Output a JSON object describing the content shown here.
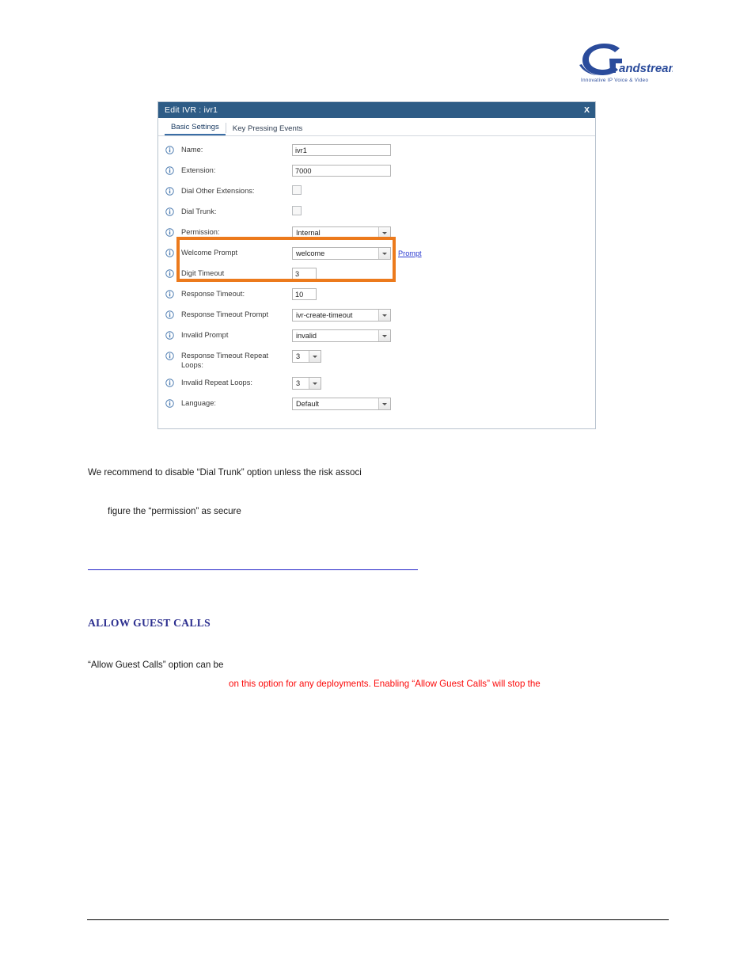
{
  "brand": {
    "name": "Grandstream",
    "tagline": "Innovative IP Voice & Video",
    "logo_color": "#2a4b9b"
  },
  "dialog": {
    "title": "Edit IVR : ivr1",
    "close_label": "X",
    "tabs": [
      {
        "label": "Basic Settings",
        "active": true
      },
      {
        "label": "Key Pressing Events",
        "active": false
      }
    ],
    "highlight_color": "#ec7a1c",
    "titlebar_color": "#2e5c86",
    "fields": [
      {
        "label": "Name:",
        "type": "text",
        "value": "ivr1"
      },
      {
        "label": "Extension:",
        "type": "text",
        "value": "7000"
      },
      {
        "label": "Dial Other Extensions:",
        "type": "checkbox",
        "checked": false
      },
      {
        "label": "Dial Trunk:",
        "type": "checkbox",
        "checked": false
      },
      {
        "label": "Permission:",
        "type": "select",
        "value": "Internal"
      },
      {
        "label": "Welcome Prompt",
        "type": "select",
        "value": "welcome",
        "link": "Prompt"
      },
      {
        "label": "Digit Timeout",
        "type": "text",
        "value": "3"
      },
      {
        "label": "Response Timeout:",
        "type": "text",
        "value": "10"
      },
      {
        "label": "Response Timeout Prompt",
        "type": "select",
        "value": "ivr-create-timeout"
      },
      {
        "label": "Invalid Prompt",
        "type": "select",
        "value": "invalid"
      },
      {
        "label": "Response Timeout Repeat Loops:",
        "type": "select-tiny",
        "value": "3"
      },
      {
        "label": "Invalid Repeat Loops:",
        "type": "select-tiny",
        "value": "3"
      },
      {
        "label": "Language:",
        "type": "select",
        "value": "Default"
      }
    ]
  },
  "document": {
    "paragraph_1": "We recommend to disable “Dial Trunk” option unless the risk associ",
    "paragraph_2": "figure the “permission” as secure",
    "section_heading": "ALLOW GUEST CALLS",
    "paragraph_3": "“Allow  Guest  Calls”  option  can  be",
    "paragraph_4_red": "on this option for any deployments. Enabling “Allow Guest Calls” will stop the"
  }
}
